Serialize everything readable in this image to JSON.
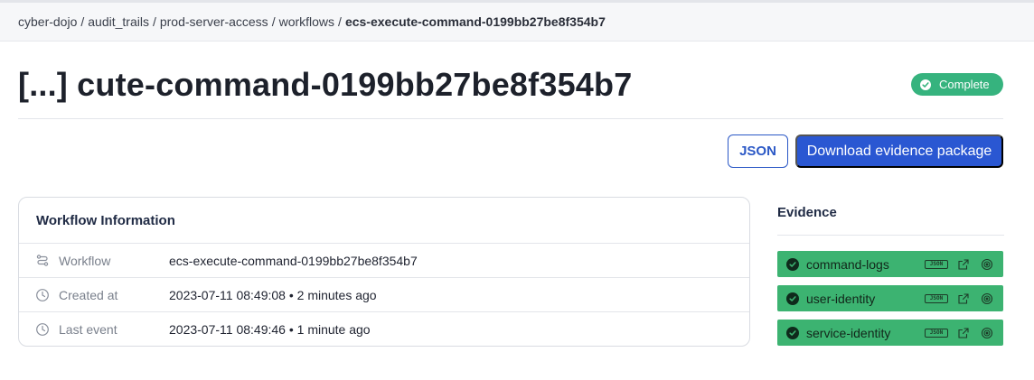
{
  "breadcrumb": {
    "items": [
      "cyber-dojo",
      "audit_trails",
      "prod-server-access",
      "workflows"
    ],
    "separator": "/",
    "current": "ecs-execute-command-0199bb27be8f354b7"
  },
  "page": {
    "title": "[...] cute-command-0199bb27be8f354b7",
    "status": "Complete"
  },
  "actions": {
    "json_label": "JSON",
    "download_label": "Download evidence package"
  },
  "workflow_info": {
    "heading": "Workflow Information",
    "rows": [
      {
        "icon": "workflow-icon",
        "label": "Workflow",
        "value": "ecs-execute-command-0199bb27be8f354b7"
      },
      {
        "icon": "clock-icon",
        "label": "Created at",
        "value": "2023-07-11 08:49:08 • 2 minutes ago"
      },
      {
        "icon": "clock-icon",
        "label": "Last event",
        "value": "2023-07-11 08:49:46 • 1 minute ago"
      }
    ]
  },
  "evidence": {
    "heading": "Evidence",
    "json_tag": "JSON",
    "items": [
      {
        "label": "command-logs"
      },
      {
        "label": "user-identity"
      },
      {
        "label": "service-identity"
      }
    ]
  },
  "colors": {
    "primary": "#2a57d2",
    "success": "#36b37e",
    "evidence_bg": "#3cb371"
  }
}
